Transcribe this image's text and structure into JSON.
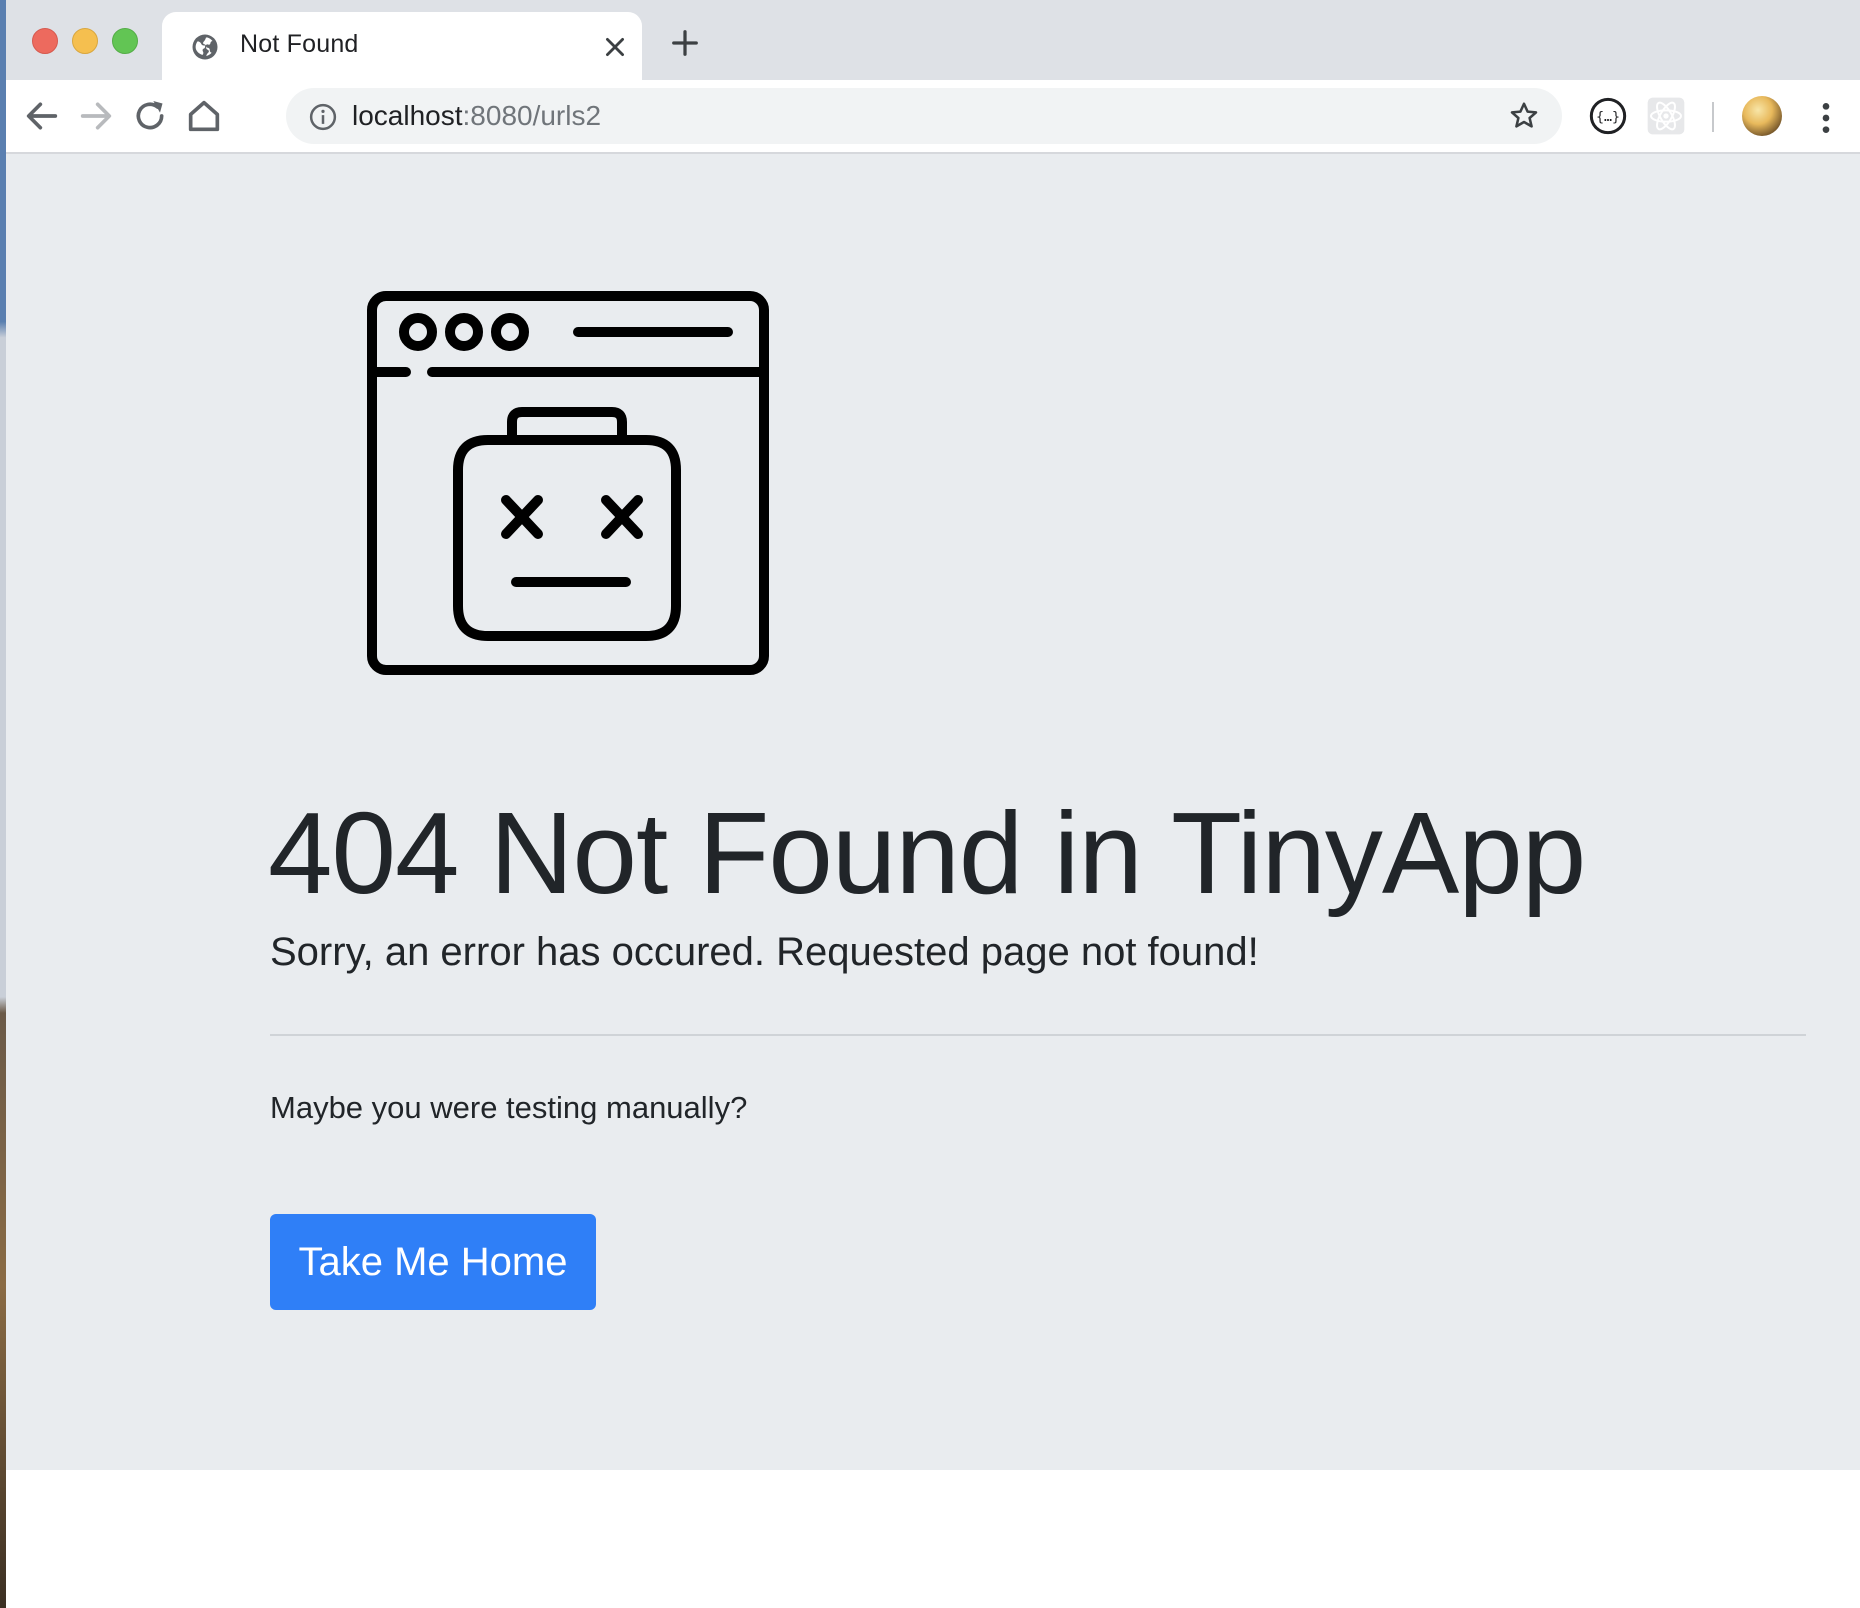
{
  "window": {
    "tab": {
      "title": "Not Found",
      "favicon": "globe-icon"
    },
    "new_tab_icon": "plus-icon"
  },
  "toolbar": {
    "url_host": "localhost",
    "url_rest": ":8080/urls2",
    "icons": [
      "back-arrow-icon",
      "forward-arrow-icon",
      "reload-icon",
      "home-icon",
      "info-icon",
      "star-icon",
      "json-extension-icon",
      "react-devtools-icon",
      "avatar",
      "more-vert-icon"
    ]
  },
  "page": {
    "illustration": "broken-browser-window-icon",
    "heading": "404 Not Found in TinyApp",
    "lead": "Sorry, an error has occured. Requested page not found!",
    "note": "Maybe you were testing manually?",
    "home_button": "Take Me Home"
  },
  "colors": {
    "page_background": "#e9ecef",
    "primary_button": "#2f7ff7",
    "text": "#212529",
    "tabstrip": "#dee1e6"
  }
}
